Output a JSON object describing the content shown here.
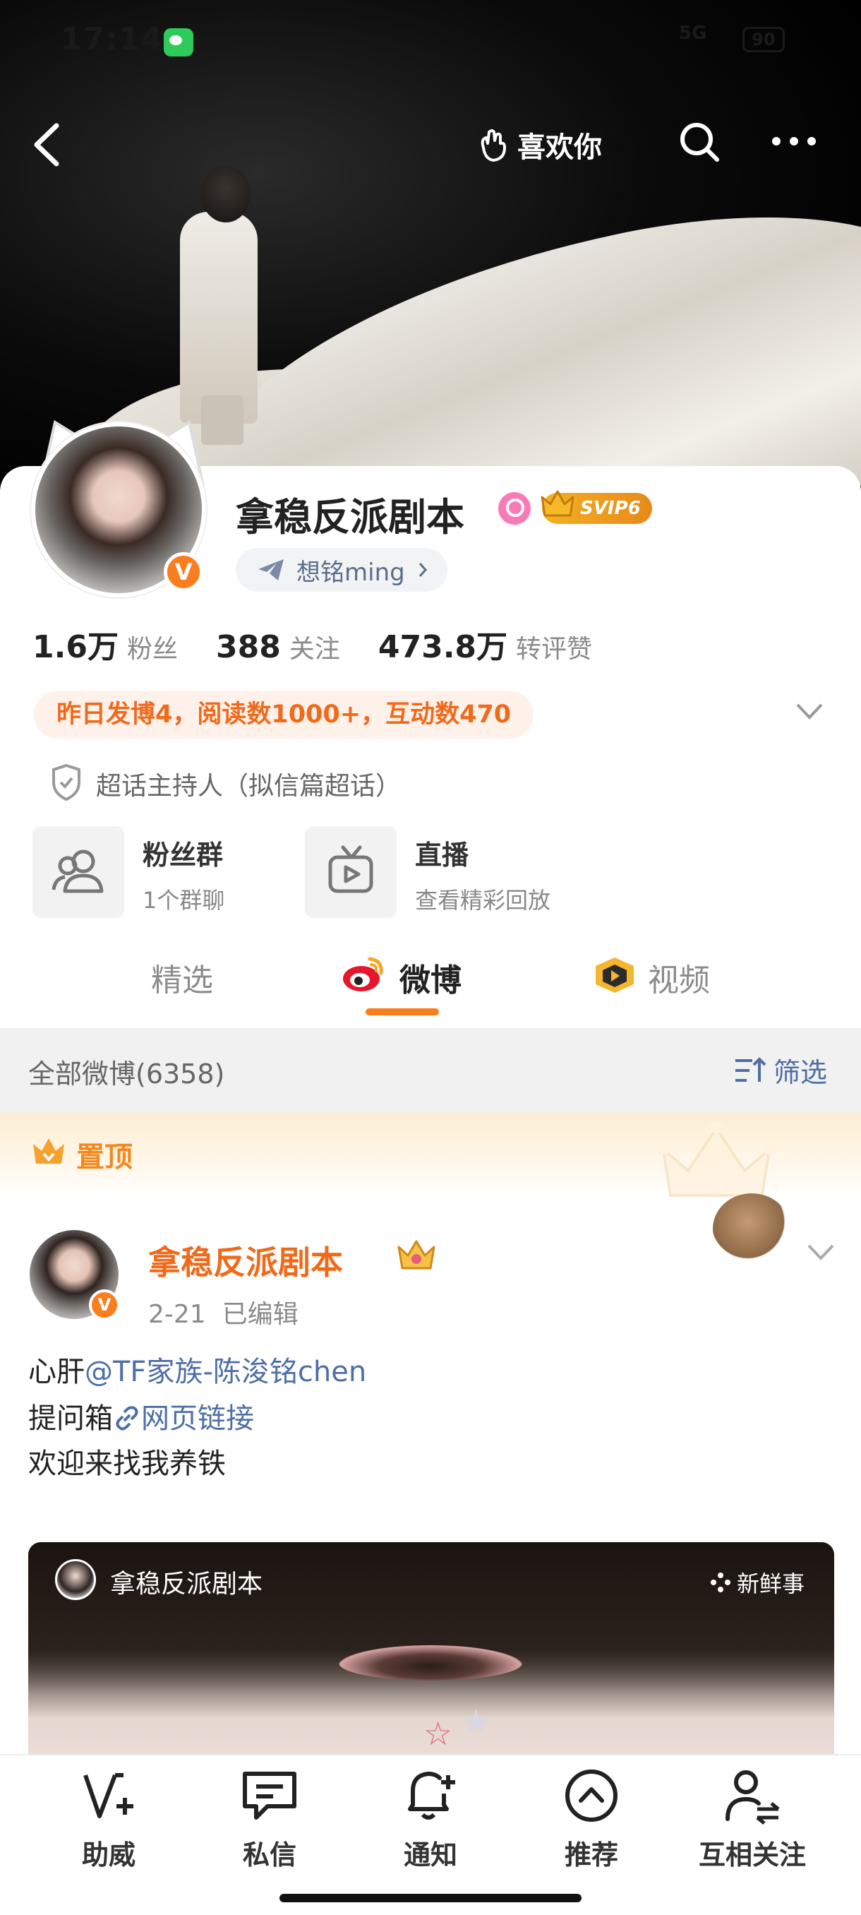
{
  "status_bar": {
    "time": "17:14",
    "signal": "5G",
    "battery": "90"
  },
  "top_nav": {
    "like_label": "喜欢你"
  },
  "profile": {
    "username": "拿稳反派剧本",
    "svip_badge": "SVIP6",
    "related_user": "想铭ming",
    "stats": [
      {
        "value": "1.6万",
        "label": "粉丝"
      },
      {
        "value": "388",
        "label": "关注"
      },
      {
        "value": "473.8万",
        "label": "转评赞"
      }
    ],
    "activity": "昨日发博4，阅读数1000+，互动数470",
    "super_topic_host": "超话主持人（拟信篇超话）",
    "quick_links": [
      {
        "title": "粉丝群",
        "subtitle": "1个群聊",
        "icon": "group-icon"
      },
      {
        "title": "直播",
        "subtitle": "查看精彩回放",
        "icon": "live-tv-icon"
      }
    ]
  },
  "tabs": [
    {
      "label": "精选",
      "active": false
    },
    {
      "label": "微博",
      "active": true
    },
    {
      "label": "视频",
      "active": false
    }
  ],
  "feed": {
    "all_posts_label": "全部微博(6358)",
    "filter_label": "筛选",
    "pinned_label": "置顶",
    "post": {
      "author": "拿稳反派剧本",
      "date": "2-21",
      "edited": "已编辑",
      "line1_prefix": "心肝",
      "line1_mention": "@TF家族-陈浚铭chen",
      "line2_prefix": "提问箱",
      "line2_link": "网页链接",
      "line3": "欢迎来找我养铁",
      "media_author": "拿稳反派剧本",
      "media_tag": "新鲜事"
    }
  },
  "bottom_nav": [
    {
      "label": "助威",
      "icon": "cheer-v-icon"
    },
    {
      "label": "私信",
      "icon": "message-icon"
    },
    {
      "label": "通知",
      "icon": "bell-icon"
    },
    {
      "label": "推荐",
      "icon": "recommend-icon"
    },
    {
      "label": "互相关注",
      "icon": "mutual-follow-icon"
    }
  ],
  "colors": {
    "accent": "#fa7d1e",
    "link": "#4e6ea6",
    "activity_text": "#f06a1c"
  }
}
